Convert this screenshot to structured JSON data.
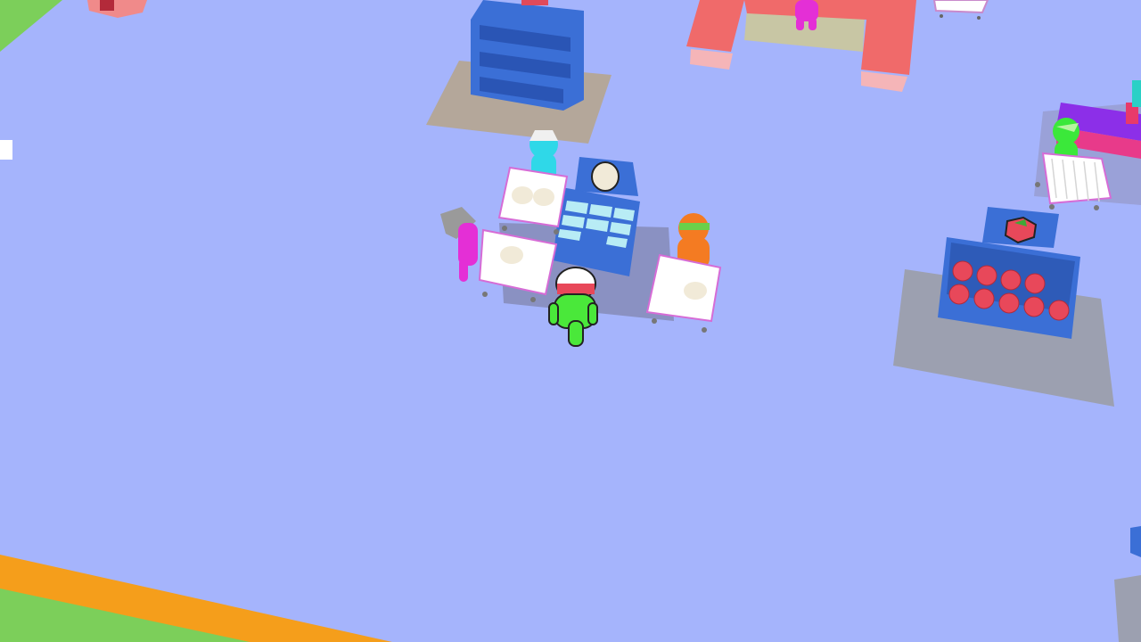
{
  "scene": {
    "type": "isometric-supermarket-game",
    "colors": {
      "floor": "#a5b4fc",
      "grass": "#7ccf5a",
      "border": "#f59e1b",
      "shelf": "#3b6fd6",
      "counter": "#f06a6a",
      "cart": "#d66cd6",
      "egg": "#f1ead8",
      "tomato": "#e8485a",
      "player": "#4ae83a"
    },
    "icons": {
      "egg_stand_sign": "egg-icon",
      "tomato_stand_sign": "tomato-icon"
    },
    "stands": [
      {
        "product": "egg",
        "slots_filled": 8
      },
      {
        "product": "tomato",
        "items_count": 10
      }
    ],
    "characters": [
      {
        "role": "player",
        "color": "#4ae83a",
        "hat": "white-red-cap"
      },
      {
        "role": "customer",
        "color": "#2fd8e8",
        "hat": "white-cap",
        "cart_items": 2
      },
      {
        "role": "customer",
        "color": "#e42fd6",
        "hat": "grey-beanie",
        "cart_items": 1
      },
      {
        "role": "customer",
        "color": "#f47b22",
        "hat": "green-band",
        "cart_items": 1
      },
      {
        "role": "customer",
        "color": "#3be83a",
        "hat": "none",
        "cart_items": 0
      },
      {
        "role": "cashier",
        "color": "#e42fd6",
        "hat": "none"
      }
    ]
  }
}
